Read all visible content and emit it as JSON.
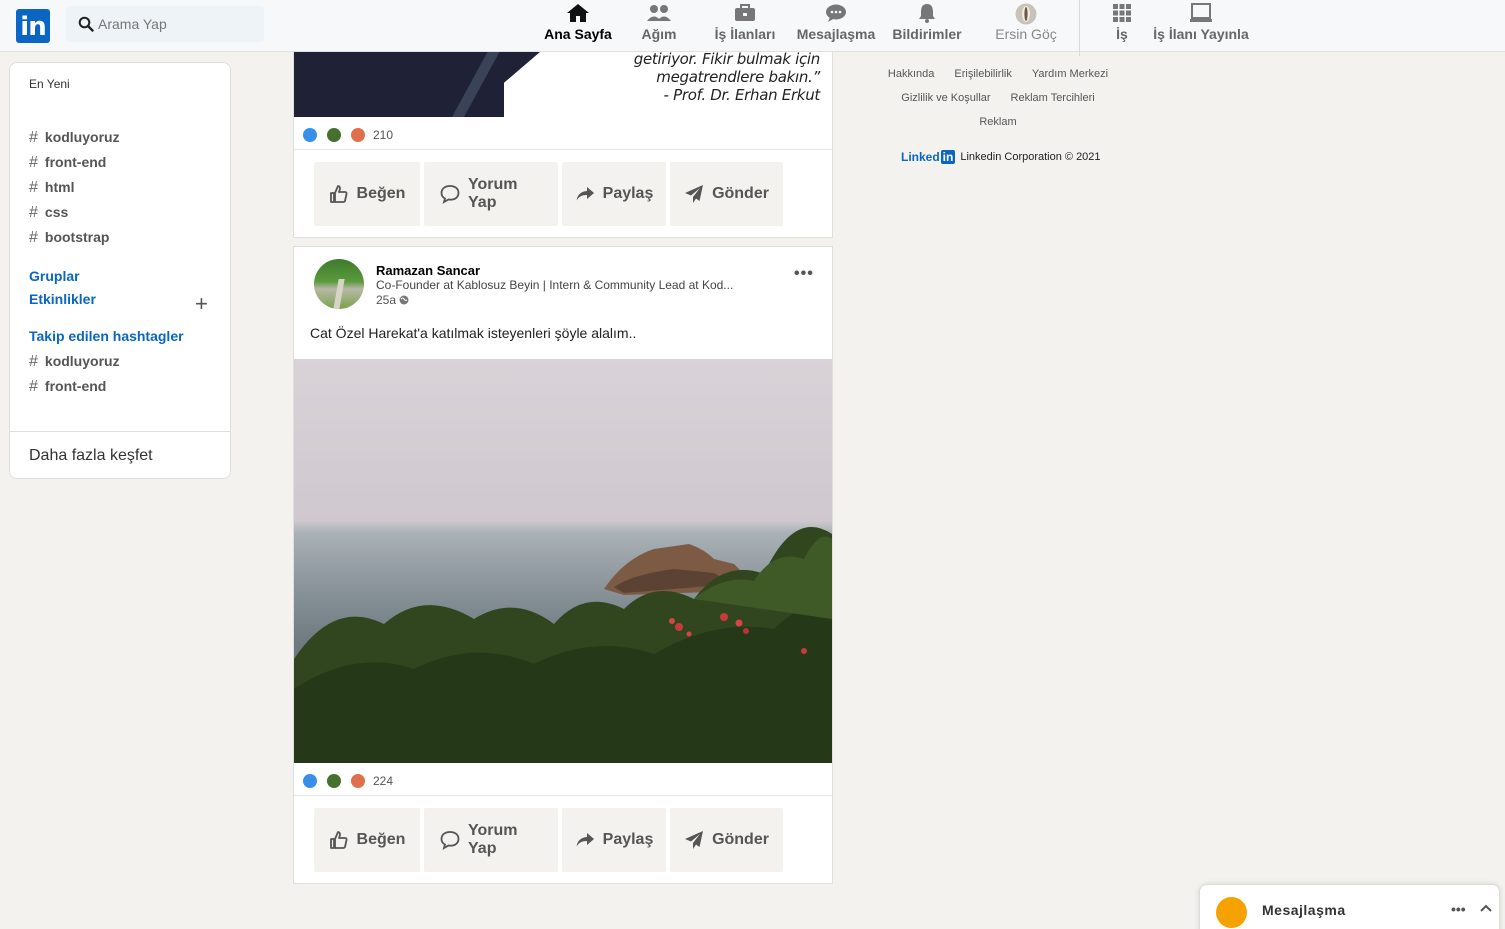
{
  "nav": {
    "logo": "in",
    "search_placeholder": "Arama Yap",
    "items": [
      {
        "label": "Ana Sayfa"
      },
      {
        "label": "Ağım"
      },
      {
        "label": "İş İlanları"
      },
      {
        "label": "Mesajlaşma"
      },
      {
        "label": "Bildirimler"
      },
      {
        "label": "Ersin Göç"
      },
      {
        "label": "İş"
      },
      {
        "label": "İş İlanı Yayınla"
      }
    ]
  },
  "sidebar": {
    "recent": "En Yeni",
    "hashtags": [
      "kodluyoruz",
      "front-end",
      "html",
      "css",
      "bootstrap"
    ],
    "groups": "Gruplar",
    "events": "Etkinlikler",
    "followed_title": "Takip edilen hashtagler",
    "followed": [
      "kodluyoruz",
      "front-end"
    ],
    "discover_more": "Daha fazla keşfet"
  },
  "post1": {
    "quote_lines": [
      "getiriyor. Fikir bulmak için",
      "megatrendlere bakın.”",
      "- Prof. Dr. Erhan Erkut"
    ],
    "reaction_count": "210"
  },
  "post2": {
    "author": "Ramazan Sancar",
    "headline": "Co-Founder at Kablosuz Beyin | Intern & Community Lead at Kod...",
    "time": "25a",
    "text": "Cat Özel Harekat'a katılmak isteyenleri şöyle alalım..",
    "reaction_count": "224"
  },
  "actions": {
    "like": "Beğen",
    "comment": "Yorum Yap",
    "share": "Paylaş",
    "send": "Gönder"
  },
  "footer": {
    "row1": [
      "Hakkında",
      "Erişilebilirlik",
      "Yardım Merkezi"
    ],
    "row2": [
      "Gizlilik ve Koşullar",
      "Reklam Tercihleri"
    ],
    "row3": [
      "Reklam"
    ],
    "brand_word": "Linked",
    "brand_in": "in",
    "copyright": "Linkedin Corporation © 2021"
  },
  "messaging": {
    "label": "Mesajlaşma"
  },
  "colors": {
    "brand": "#0a66c2",
    "background": "#f3f2ef"
  }
}
